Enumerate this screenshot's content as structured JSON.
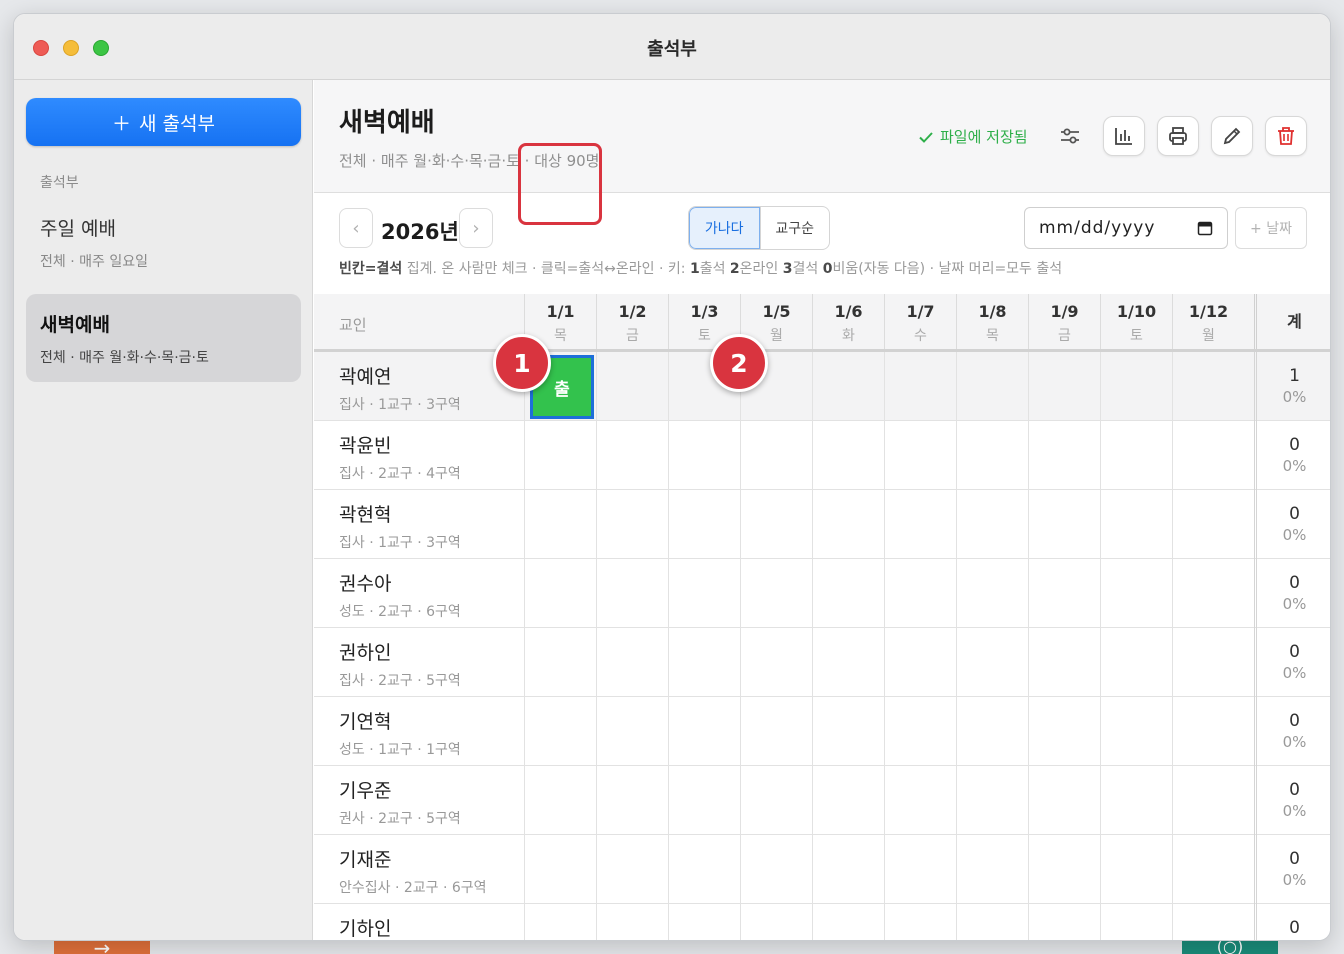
{
  "window": {
    "title": "출석부"
  },
  "sidebar": {
    "new_button": "새 출석부",
    "section_label": "출석부",
    "items": [
      {
        "name": "주일 예배",
        "sub": "전체 · 매주 일요일"
      },
      {
        "name": "새벽예배",
        "sub": "전체 · 매주 월·화·수·목·금·토"
      }
    ]
  },
  "header": {
    "title": "새벽예배",
    "subtitle": "전체 · 매주 월·화·수·목·금·토 · 대상 90명",
    "saved_label": "파일에 저장됨",
    "icons": [
      "sliders-icon",
      "chart-icon",
      "print-icon",
      "edit-icon",
      "trash-icon"
    ]
  },
  "toolbar": {
    "year": "2026년",
    "sort_options": [
      "가나다",
      "교구순"
    ],
    "sort_selected": "가나다",
    "date_placeholder": "mm/dd/yyyy",
    "add_date": "+ 날짜",
    "hint": {
      "p1": "빈칸=결석",
      "p2": " 집계. 온 사람만 체크 · 클릭=출석↔온라인 · 키: ",
      "p3": "1",
      "p4": "출석 ",
      "p5": "2",
      "p6": "온라인 ",
      "p7": "3",
      "p8": "결석 ",
      "p9": "0",
      "p10": "비움(자동 다음) · 날짜 머리=모두 출석"
    }
  },
  "grid": {
    "name_header": "교인",
    "total_header": "계",
    "columns": [
      {
        "date": "1/1",
        "dow": "목"
      },
      {
        "date": "1/2",
        "dow": "금"
      },
      {
        "date": "1/3",
        "dow": "토"
      },
      {
        "date": "1/5",
        "dow": "월"
      },
      {
        "date": "1/6",
        "dow": "화"
      },
      {
        "date": "1/7",
        "dow": "수"
      },
      {
        "date": "1/8",
        "dow": "목"
      },
      {
        "date": "1/9",
        "dow": "금"
      },
      {
        "date": "1/10",
        "dow": "토"
      },
      {
        "date": "1/12",
        "dow": "월"
      }
    ],
    "present_label": "출",
    "rows": [
      {
        "name": "곽예연",
        "sub": "집사 · 1교구 · 3구역",
        "count": "1",
        "pct": "0%"
      },
      {
        "name": "곽윤빈",
        "sub": "집사 · 2교구 · 4구역",
        "count": "0",
        "pct": "0%"
      },
      {
        "name": "곽현혁",
        "sub": "집사 · 1교구 · 3구역",
        "count": "0",
        "pct": "0%"
      },
      {
        "name": "권수아",
        "sub": "성도 · 2교구 · 6구역",
        "count": "0",
        "pct": "0%"
      },
      {
        "name": "권하인",
        "sub": "집사 · 2교구 · 5구역",
        "count": "0",
        "pct": "0%"
      },
      {
        "name": "기연혁",
        "sub": "성도 · 1교구 · 1구역",
        "count": "0",
        "pct": "0%"
      },
      {
        "name": "기우준",
        "sub": "권사 · 2교구 · 5구역",
        "count": "0",
        "pct": "0%"
      },
      {
        "name": "기재준",
        "sub": "안수집사 · 2교구 · 6구역",
        "count": "0",
        "pct": "0%"
      },
      {
        "name": "기하인",
        "sub": "",
        "count": "0",
        "pct": ""
      }
    ]
  },
  "markers": [
    "1",
    "2"
  ],
  "colors": {
    "accent": "#1a72f2",
    "present": "#33c24d",
    "marker": "#d9343f",
    "saved": "#2eaf4a"
  }
}
